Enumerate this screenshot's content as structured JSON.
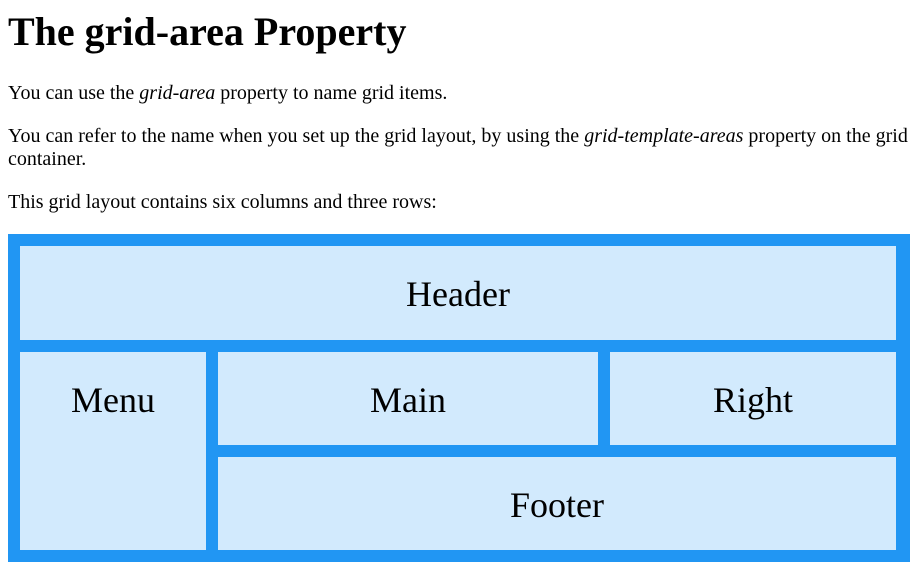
{
  "page": {
    "title": "The grid-area Property",
    "para1_before": "You can use the ",
    "para1_em": "grid-area",
    "para1_after": " property to name grid items.",
    "para2_before": "You can refer to the name when you set up the grid layout, by using the ",
    "para2_em": "grid-template-areas",
    "para2_after": " property on the grid container.",
    "para3": "This grid layout contains six columns and three rows:"
  },
  "grid": {
    "header": "Header",
    "menu": "Menu",
    "main": "Main",
    "right": "Right",
    "footer": "Footer"
  },
  "colors": {
    "container_bg": "#2196F3",
    "item_bg": "rgba(255,255,255,0.8)"
  }
}
